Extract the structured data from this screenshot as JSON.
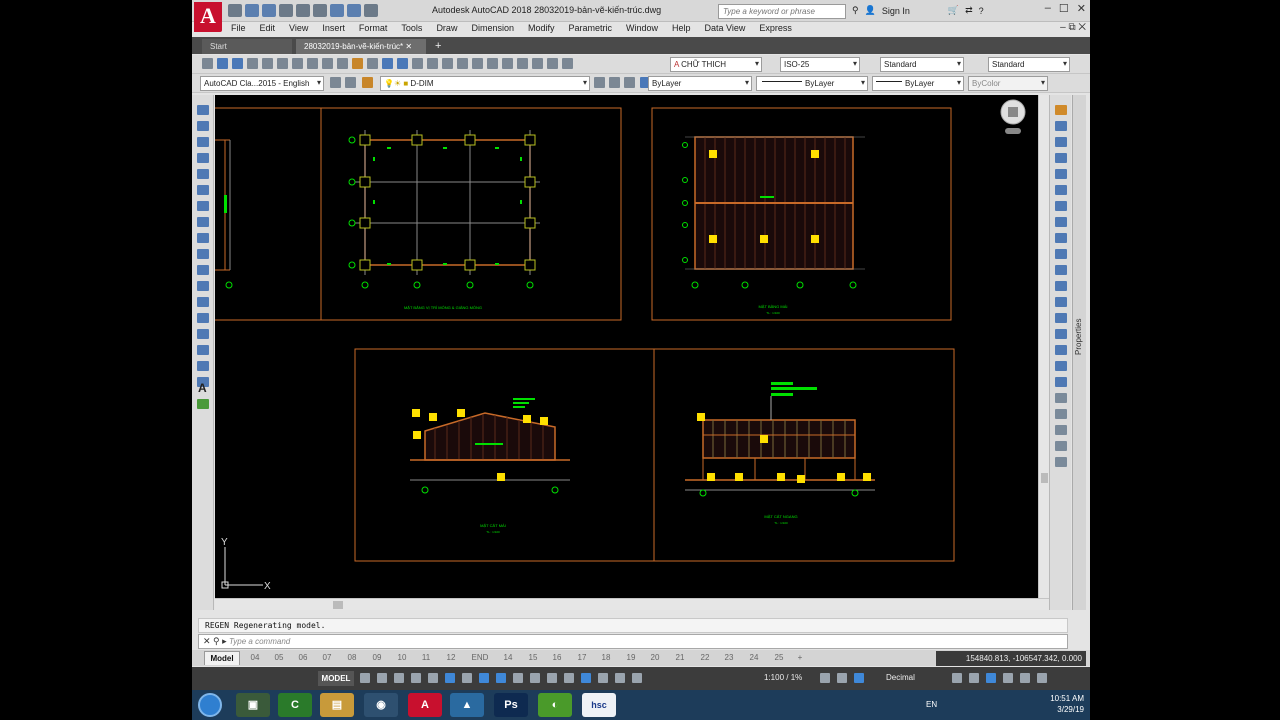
{
  "window": {
    "app_letter": "A",
    "title": "Autodesk AutoCAD 2018    28032019-bản-vẽ-kiến-trúc.dwg",
    "search_placeholder": "Type a keyword or phrase",
    "sign_in": "Sign In"
  },
  "menu": [
    "File",
    "Edit",
    "View",
    "Insert",
    "Format",
    "Tools",
    "Draw",
    "Dimension",
    "Modify",
    "Parametric",
    "Window",
    "Help",
    "Data View",
    "Express"
  ],
  "file_tabs": {
    "start": "Start",
    "active": "28032019-bản-vẽ-kiến-trúc*",
    "new": "+"
  },
  "toolbar": {
    "text_style": "CHỮ THICH",
    "dim_style": "ISO-25",
    "table_style": "Standard",
    "mleader_style": "Standard",
    "workspace": "AutoCAD Cla...2015 - English",
    "layer": "D-DIM",
    "color": "ByLayer",
    "linetype": "ByLayer",
    "lineweight": "ByLayer",
    "plotstyle": "ByColor"
  },
  "drawing": {
    "title_plan": "MẶT BẰNG VỊ TRÍ MÓNG & GIẰNG MÓNG",
    "title_roof": "MẶT BẰNG MÁI",
    "title_section1": "MẶT CẮT MÁI",
    "title_section2": "MẶT CẮT NGANG",
    "scale_label": "TL : 1/100",
    "ucs_y": "Y",
    "ucs_x": "X"
  },
  "command": {
    "history": "REGEN Regenerating model.",
    "placeholder": "Type a command"
  },
  "layout_tabs": [
    "Model",
    "04",
    "05",
    "06",
    "07",
    "08",
    "09",
    "10",
    "11",
    "12",
    "END",
    "14",
    "15",
    "16",
    "17",
    "18",
    "19",
    "20",
    "21",
    "22",
    "23",
    "24",
    "25",
    "+"
  ],
  "coordinates": "154840.813, -106547.342, 0.000",
  "status": {
    "model": "MODEL",
    "scale": "1:100 / 1%",
    "units": "Decimal"
  },
  "taskbar": {
    "apps": [
      "explorer",
      "camtasia",
      "files",
      "chrome",
      "autocad",
      "sketchup",
      "photoshop",
      "browser",
      "hsc"
    ],
    "hsc_label": "hsc",
    "ps_label": "Ps",
    "lang": "EN",
    "time": "10:51 AM",
    "date": "3/29/19"
  }
}
